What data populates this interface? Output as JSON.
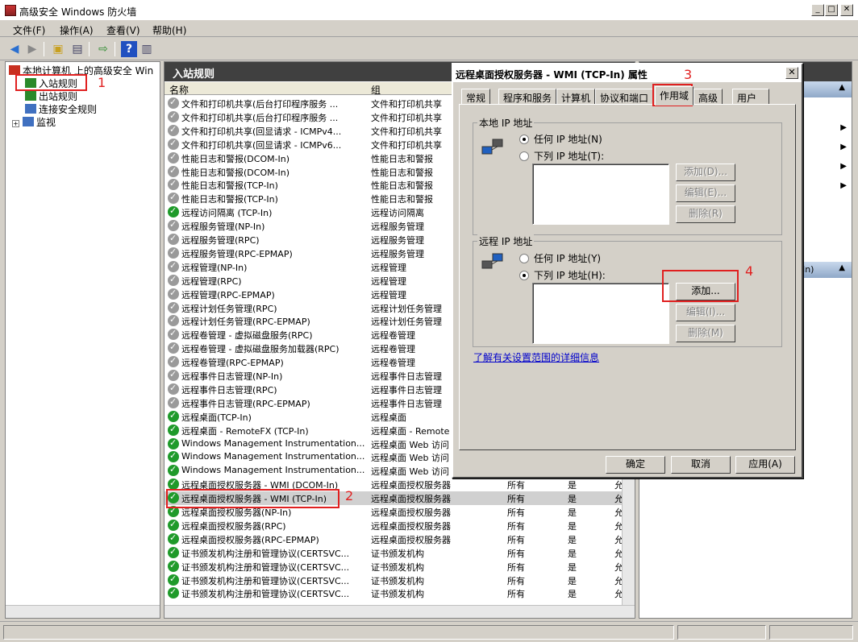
{
  "window": {
    "title": "高级安全 Windows 防火墙"
  },
  "menu": [
    "文件(F)",
    "操作(A)",
    "查看(V)",
    "帮助(H)"
  ],
  "tree": {
    "root": "本地计算机 上的高级安全 Win",
    "items": [
      "入站规则",
      "出站规则",
      "连接安全规则",
      "监视"
    ]
  },
  "main": {
    "header": "入站规则",
    "columns": [
      "名称",
      "组"
    ],
    "rows": [
      {
        "name": "文件和打印机共享(后台打印程序服务 ...",
        "group": "文件和打印机共享",
        "on": false
      },
      {
        "name": "文件和打印机共享(后台打印程序服务 ...",
        "group": "文件和打印机共享",
        "on": false
      },
      {
        "name": "文件和打印机共享(回显请求 - ICMPv4...",
        "group": "文件和打印机共享",
        "on": false
      },
      {
        "name": "文件和打印机共享(回显请求 - ICMPv6...",
        "group": "文件和打印机共享",
        "on": false
      },
      {
        "name": "性能日志和警报(DCOM-In)",
        "group": "性能日志和警报",
        "on": false
      },
      {
        "name": "性能日志和警报(DCOM-In)",
        "group": "性能日志和警报",
        "on": false
      },
      {
        "name": "性能日志和警报(TCP-In)",
        "group": "性能日志和警报",
        "on": false
      },
      {
        "name": "性能日志和警报(TCP-In)",
        "group": "性能日志和警报",
        "on": false
      },
      {
        "name": "远程访问隔离 (TCP-In)",
        "group": "远程访问隔离",
        "on": true
      },
      {
        "name": "远程服务管理(NP-In)",
        "group": "远程服务管理",
        "on": false
      },
      {
        "name": "远程服务管理(RPC)",
        "group": "远程服务管理",
        "on": false
      },
      {
        "name": "远程服务管理(RPC-EPMAP)",
        "group": "远程服务管理",
        "on": false
      },
      {
        "name": "远程管理(NP-In)",
        "group": "远程管理",
        "on": false
      },
      {
        "name": "远程管理(RPC)",
        "group": "远程管理",
        "on": false
      },
      {
        "name": "远程管理(RPC-EPMAP)",
        "group": "远程管理",
        "on": false
      },
      {
        "name": "远程计划任务管理(RPC)",
        "group": "远程计划任务管理",
        "on": false
      },
      {
        "name": "远程计划任务管理(RPC-EPMAP)",
        "group": "远程计划任务管理",
        "on": false
      },
      {
        "name": "远程卷管理 - 虚拟磁盘服务(RPC)",
        "group": "远程卷管理",
        "on": false
      },
      {
        "name": "远程卷管理 - 虚拟磁盘服务加载器(RPC)",
        "group": "远程卷管理",
        "on": false
      },
      {
        "name": "远程卷管理(RPC-EPMAP)",
        "group": "远程卷管理",
        "on": false
      },
      {
        "name": "远程事件日志管理(NP-In)",
        "group": "远程事件日志管理",
        "on": false
      },
      {
        "name": "远程事件日志管理(RPC)",
        "group": "远程事件日志管理",
        "on": false
      },
      {
        "name": "远程事件日志管理(RPC-EPMAP)",
        "group": "远程事件日志管理",
        "on": false
      },
      {
        "name": "远程桌面(TCP-In)",
        "group": "远程桌面",
        "on": true
      },
      {
        "name": "远程桌面 - RemoteFX (TCP-In)",
        "group": "远程桌面 - Remote",
        "on": true
      },
      {
        "name": "Windows Management Instrumentation...",
        "group": "远程桌面 Web 访问",
        "on": true
      },
      {
        "name": "Windows Management Instrumentation...",
        "group": "远程桌面 Web 访问",
        "on": true
      },
      {
        "name": "Windows Management Instrumentation...",
        "group": "远程桌面 Web 访问",
        "on": true
      },
      {
        "name": "远程桌面授权服务器 - WMI (DCOM-In)",
        "group": "远程桌面授权服务器",
        "profile": "所有",
        "enabled": "是",
        "action": "允",
        "on": true
      },
      {
        "name": "远程桌面授权服务器 - WMI (TCP-In)",
        "group": "远程桌面授权服务器",
        "profile": "所有",
        "enabled": "是",
        "action": "允",
        "on": true,
        "selected": true
      },
      {
        "name": "远程桌面授权服务器(NP-In)",
        "group": "远程桌面授权服务器",
        "profile": "所有",
        "enabled": "是",
        "action": "允",
        "on": true
      },
      {
        "name": "远程桌面授权服务器(RPC)",
        "group": "远程桌面授权服务器",
        "profile": "所有",
        "enabled": "是",
        "action": "允",
        "on": true
      },
      {
        "name": "远程桌面授权服务器(RPC-EPMAP)",
        "group": "远程桌面授权服务器",
        "profile": "所有",
        "enabled": "是",
        "action": "允",
        "on": true
      },
      {
        "name": "证书颁发机构注册和管理协议(CERTSVC...",
        "group": "证书颁发机构",
        "profile": "所有",
        "enabled": "是",
        "action": "允",
        "on": true
      },
      {
        "name": "证书颁发机构注册和管理协议(CERTSVC...",
        "group": "证书颁发机构",
        "profile": "所有",
        "enabled": "是",
        "action": "允",
        "on": true
      },
      {
        "name": "证书颁发机构注册和管理协议(CERTSVC...",
        "group": "证书颁发机构",
        "profile": "所有",
        "enabled": "是",
        "action": "允",
        "on": true
      },
      {
        "name": "证书颁发机构注册和管理协议(CERTSVC...",
        "group": "证书颁发机构",
        "profile": "所有",
        "enabled": "是",
        "action": "允",
        "on": true
      }
    ]
  },
  "right": {
    "section_text": "-In)"
  },
  "dialog": {
    "title": "远程桌面授权服务器 - WMI (TCP-In) 属性",
    "tabs": [
      "常规",
      "程序和服务",
      "计算机",
      "协议和端口",
      "作用域",
      "高级",
      "用户"
    ],
    "local": {
      "legend": "本地 IP 地址",
      "any": "任何 IP 地址(N)",
      "these": "下列 IP 地址(T):",
      "add": "添加(D)...",
      "edit": "编辑(E)...",
      "remove": "删除(R)"
    },
    "remote": {
      "legend": "远程 IP 地址",
      "any": "任何 IP 地址(Y)",
      "these": "下列 IP 地址(H):",
      "add": "添加...",
      "edit": "编辑(I)...",
      "remove": "删除(M)"
    },
    "link": "了解有关设置范围的详细信息",
    "ok": "确定",
    "cancel": "取消",
    "apply": "应用(A)"
  },
  "annotations": [
    "1",
    "2",
    "3",
    "4"
  ]
}
